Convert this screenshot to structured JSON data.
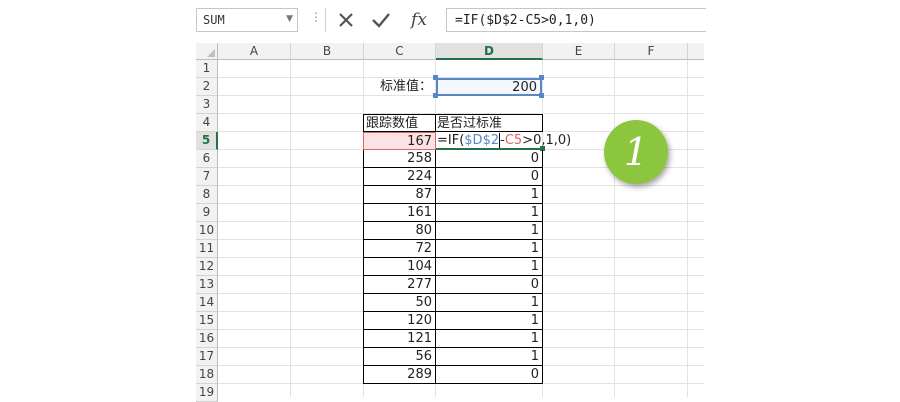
{
  "namebox": {
    "value": "SUM"
  },
  "formula_bar": {
    "separator": "⋮",
    "cancel_icon": "close-icon",
    "enter_icon": "check-icon",
    "function_label": "fx",
    "formula": "=IF($D$2-C5>0,1,0)"
  },
  "columns": [
    "A",
    "B",
    "C",
    "D",
    "E",
    "F"
  ],
  "rows": [
    "1",
    "2",
    "3",
    "4",
    "5",
    "6",
    "7",
    "8",
    "9",
    "10",
    "11",
    "12",
    "13",
    "14",
    "15",
    "16",
    "17",
    "18",
    "19"
  ],
  "cells": {
    "label_standard": "标准值：",
    "standard_value": "200",
    "header_tracking": "跟踪数值",
    "header_exceed": "是否过标准",
    "c5": "167",
    "edit_formula": {
      "p1": "=IF(",
      "p2": "$D$2",
      "p3": "-",
      "p4": "C5",
      "p5": ">0,1,0)"
    }
  },
  "data_rows": [
    {
      "row": "6",
      "c": "258",
      "d": "0"
    },
    {
      "row": "7",
      "c": "224",
      "d": "0"
    },
    {
      "row": "8",
      "c": "87",
      "d": "1"
    },
    {
      "row": "9",
      "c": "161",
      "d": "1"
    },
    {
      "row": "10",
      "c": "80",
      "d": "1"
    },
    {
      "row": "11",
      "c": "72",
      "d": "1"
    },
    {
      "row": "12",
      "c": "104",
      "d": "1"
    },
    {
      "row": "13",
      "c": "277",
      "d": "0"
    },
    {
      "row": "14",
      "c": "50",
      "d": "1"
    },
    {
      "row": "15",
      "c": "120",
      "d": "1"
    },
    {
      "row": "16",
      "c": "121",
      "d": "1"
    },
    {
      "row": "17",
      "c": "56",
      "d": "1"
    },
    {
      "row": "18",
      "c": "289",
      "d": "0"
    }
  ],
  "step_badge": "1",
  "colors": {
    "accent_green": "#217346",
    "badge_green": "#8cc63e",
    "ref_blue": "#5b86c5",
    "ref_red": "#e06666"
  }
}
